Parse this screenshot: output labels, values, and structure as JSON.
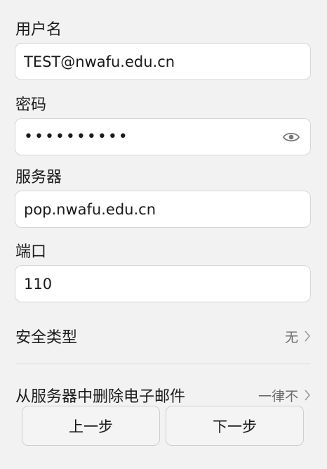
{
  "form": {
    "username_label": "用户名",
    "username_value": "TEST@nwafu.edu.cn",
    "password_label": "密码",
    "password_value": "••••••••••",
    "server_label": "服务器",
    "server_value": "pop.nwafu.edu.cn",
    "port_label": "端口",
    "port_value": "110"
  },
  "settings": {
    "security_label": "安全类型",
    "security_value": "无",
    "delete_label": "从服务器中删除电子邮件",
    "delete_value": "一律不"
  },
  "buttons": {
    "prev": "上一步",
    "next": "下一步"
  },
  "icons": {
    "password_toggle": "eye-icon",
    "row_arrow": "chevron-right-icon"
  }
}
